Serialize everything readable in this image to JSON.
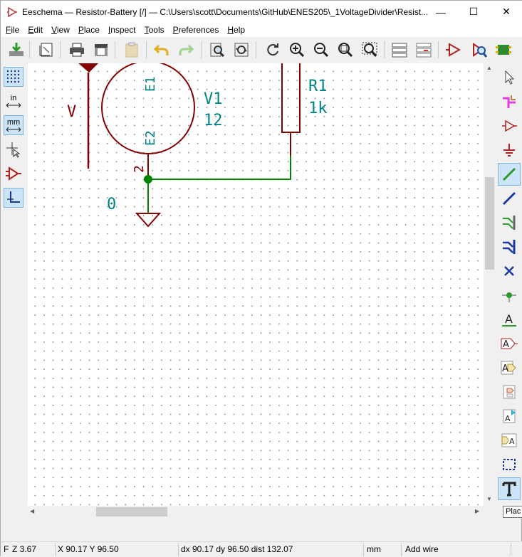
{
  "window": {
    "title": "Eeschema — Resistor-Battery [/] — C:\\Users\\scott\\Documents\\GitHub\\ENES205\\_1VoltageDivider\\Resist...",
    "minimize_glyph": "—",
    "maximize_glyph": "☐",
    "close_glyph": "✕"
  },
  "menu": [
    {
      "label": "File",
      "accel": "F"
    },
    {
      "label": "Edit",
      "accel": "E"
    },
    {
      "label": "View",
      "accel": "V"
    },
    {
      "label": "Place",
      "accel": "P"
    },
    {
      "label": "Inspect",
      "accel": "I"
    },
    {
      "label": "Tools",
      "accel": "T"
    },
    {
      "label": "Preferences",
      "accel": "P"
    },
    {
      "label": "Help",
      "accel": "H"
    }
  ],
  "left_toolbar": {
    "inch_label": "in",
    "mm_label": "mm"
  },
  "schematic": {
    "power_label": "V",
    "source_ref": "V1",
    "source_value": "12",
    "source_pin_top": "E1",
    "source_pin_bottom": "E2",
    "source_pin_number": "2",
    "resistor_ref": "R1",
    "resistor_value": "1k",
    "ground_label": "0",
    "colors": {
      "symbol": "#840000",
      "field": "#008484",
      "wire": "#008400",
      "junction": "#008400"
    }
  },
  "tooltip": "Plac",
  "status": {
    "zoom": "Z 3.67",
    "zoom_prefix": "F",
    "cursor": "X 90.17  Y 96.50",
    "delta": "dx 90.17  dy 96.50  dist 132.07",
    "units": "mm",
    "mode": "Add wire"
  }
}
